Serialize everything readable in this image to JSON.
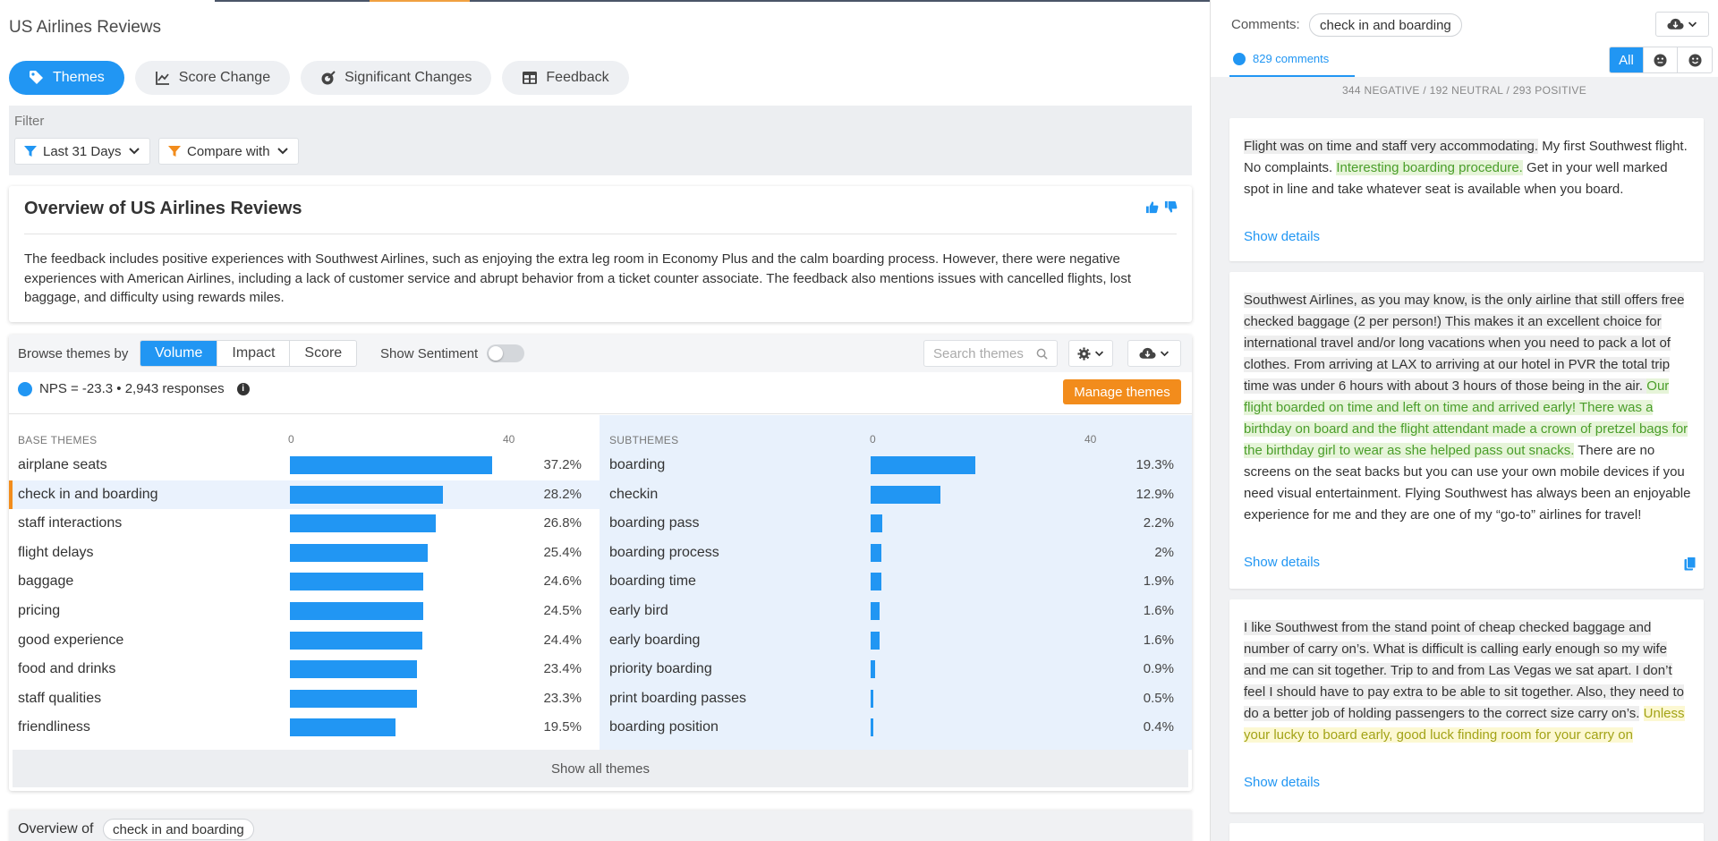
{
  "app": {
    "title": "US Airlines Reviews"
  },
  "nav": {
    "tabs": [
      {
        "label": "Themes",
        "icon": "tag-icon",
        "active": true
      },
      {
        "label": "Score Change",
        "icon": "line-chart-icon",
        "active": false
      },
      {
        "label": "Significant Changes",
        "icon": "target-icon",
        "active": false
      },
      {
        "label": "Feedback",
        "icon": "table-icon",
        "active": false
      }
    ]
  },
  "filter": {
    "label": "Filter",
    "date_range": "Last 31 Days",
    "compare": "Compare with"
  },
  "overview": {
    "title": "Overview of US Airlines Reviews",
    "body": "The feedback includes positive experiences with Southwest Airlines, such as enjoying the extra leg room in Economy Plus and the calm boarding process. However, there were negative experiences with American Airlines, including a lack of customer service and abrupt behavior from a ticket counter associate. The feedback also mentions issues with cancelled flights, lost baggage, and difficulty using rewards miles."
  },
  "browse": {
    "label": "Browse themes by",
    "modes": [
      "Volume",
      "Impact",
      "Score"
    ],
    "active_mode": "Volume",
    "show_sentiment_label": "Show Sentiment",
    "show_sentiment": false,
    "search_placeholder": "Search themes",
    "nps_text": "NPS = -23.3 • 2,943 responses",
    "manage_label": "Manage themes",
    "show_all_label": "Show all themes"
  },
  "base_themes": {
    "header": "BASE THEMES",
    "axis_ticks": [
      "0",
      "40"
    ],
    "axis_max": 40,
    "selected": "check in and boarding",
    "rows": [
      {
        "label": "airplane seats",
        "value": 37.2,
        "pct": "37.2%"
      },
      {
        "label": "check in and boarding",
        "value": 28.2,
        "pct": "28.2%"
      },
      {
        "label": "staff interactions",
        "value": 26.8,
        "pct": "26.8%"
      },
      {
        "label": "flight delays",
        "value": 25.4,
        "pct": "25.4%"
      },
      {
        "label": "baggage",
        "value": 24.6,
        "pct": "24.6%"
      },
      {
        "label": "pricing",
        "value": 24.5,
        "pct": "24.5%"
      },
      {
        "label": "good experience",
        "value": 24.4,
        "pct": "24.4%"
      },
      {
        "label": "food and drinks",
        "value": 23.4,
        "pct": "23.4%"
      },
      {
        "label": "staff qualities",
        "value": 23.3,
        "pct": "23.3%"
      },
      {
        "label": "friendliness",
        "value": 19.5,
        "pct": "19.5%"
      }
    ]
  },
  "sub_themes": {
    "header": "SUBTHEMES",
    "axis_ticks": [
      "0",
      "40"
    ],
    "axis_max": 40,
    "rows": [
      {
        "label": "boarding",
        "value": 19.3,
        "pct": "19.3%"
      },
      {
        "label": "checkin",
        "value": 12.9,
        "pct": "12.9%"
      },
      {
        "label": "boarding pass",
        "value": 2.2,
        "pct": "2.2%"
      },
      {
        "label": "boarding process",
        "value": 2.0,
        "pct": "2%"
      },
      {
        "label": "boarding time",
        "value": 1.9,
        "pct": "1.9%"
      },
      {
        "label": "early bird",
        "value": 1.6,
        "pct": "1.6%"
      },
      {
        "label": "early boarding",
        "value": 1.6,
        "pct": "1.6%"
      },
      {
        "label": "priority boarding",
        "value": 0.9,
        "pct": "0.9%"
      },
      {
        "label": "print boarding passes",
        "value": 0.5,
        "pct": "0.5%"
      },
      {
        "label": "boarding position",
        "value": 0.4,
        "pct": "0.4%"
      }
    ]
  },
  "bottom": {
    "label": "Overview of",
    "chip": "check in and boarding"
  },
  "comments": {
    "label": "Comments:",
    "theme_chip": "check in and boarding",
    "count_label": "829 comments",
    "filters": [
      "All"
    ],
    "summary": "344 NEGATIVE / 192 NEUTRAL / 293 POSITIVE",
    "show_details_label": "Show details",
    "items": [
      {
        "segments": [
          {
            "text": "Flight was on time and staff very accommodating.",
            "tone": "neutral"
          },
          {
            "text": " My first Southwest flight. No complaints. ",
            "tone": "plain"
          },
          {
            "text": "Interesting boarding procedure.",
            "tone": "positive"
          },
          {
            "text": " Get in your well marked spot in line and take whatever seat is available when you board.",
            "tone": "plain"
          }
        ]
      },
      {
        "segments": [
          {
            "text": "Southwest Airlines, as you may know, is the only airline that still offers free checked baggage (2 per person!) This makes it an excellent choice for international travel and/or long vacations when you need to pack a lot of clothes. From arriving at LAX to arriving at our hotel in PVR the total trip time was under 6 hours with about 3 hours of those being in the air. ",
            "tone": "neutral"
          },
          {
            "text": "Our flight boarded on time and left on time and arrived early! There was a birthday on board and the flight attendant made a crown of pretzel bags for the birthday girl to wear as she helped pass out snacks.",
            "tone": "positive"
          },
          {
            "text": " There are no screens on the seat backs but you can use your own mobile devices if you need visual entertainment. Flying Southwest has always been an enjoyable experience for me and they are one of my “go-to” airlines for travel!",
            "tone": "plain"
          }
        ]
      },
      {
        "segments": [
          {
            "text": "I like Southwest from the stand point of cheap checked baggage and number of carry on’s. What is difficult is calling early enough so my wife and me can sit together. Trip to and from Las Vegas we sat apart. I don’t feel I should have to pay extra to be able to sit together. Also, they need to do a better job of holding passengers to the correct size carry on’s.",
            "tone": "neutral"
          },
          {
            "text": " ",
            "tone": "plain"
          },
          {
            "text": "Unless your lucky to board early, good luck finding room for your carry on",
            "tone": "mixed"
          }
        ]
      }
    ]
  },
  "colors": {
    "accent": "#2196f3",
    "orange": "#f28c1c",
    "positive_text": "#4a9e2a",
    "mixed_text": "#a3a317"
  }
}
